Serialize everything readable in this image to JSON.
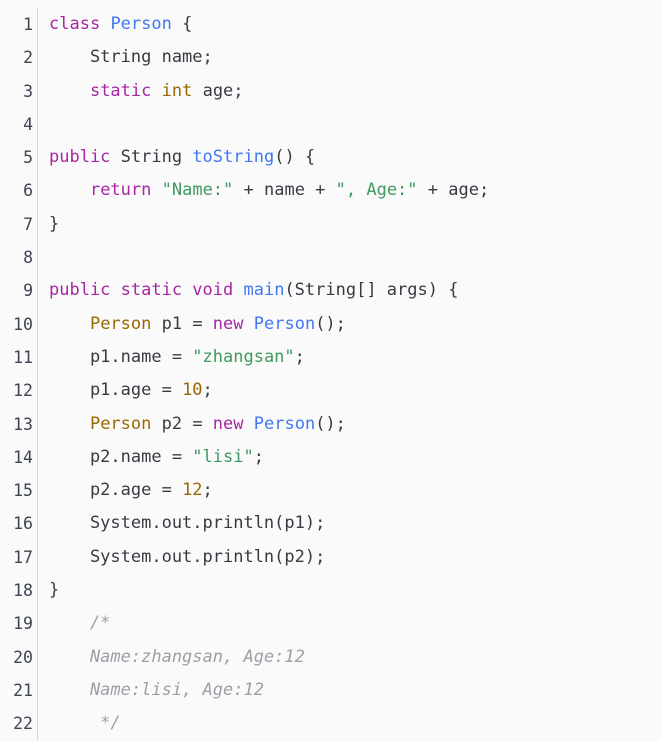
{
  "editor": {
    "language": "java",
    "background_color": "#fafafa",
    "gutter_separator_color": "#d7d7d7",
    "total_lines": 22,
    "palette": {
      "keyword": "#a626a4",
      "class_name": "#4078f2",
      "type": "#986801",
      "number": "#986801",
      "string": "#3f9960",
      "plain": "#383a42",
      "comment": "#9ca0a6",
      "line_number": "#3f4451"
    }
  },
  "lines": [
    {
      "n": "1",
      "tokens": [
        {
          "t": "class",
          "c": "kw"
        },
        {
          "t": " ",
          "c": "pln"
        },
        {
          "t": "Person",
          "c": "cls"
        },
        {
          "t": " {",
          "c": "pln"
        }
      ]
    },
    {
      "n": "2",
      "tokens": [
        {
          "t": "    String name;",
          "c": "pln"
        }
      ]
    },
    {
      "n": "3",
      "tokens": [
        {
          "t": "    ",
          "c": "pln"
        },
        {
          "t": "static",
          "c": "kw"
        },
        {
          "t": " ",
          "c": "pln"
        },
        {
          "t": "int",
          "c": "typ"
        },
        {
          "t": " age;",
          "c": "pln"
        }
      ]
    },
    {
      "n": "4",
      "tokens": [
        {
          "t": "",
          "c": "pln"
        }
      ]
    },
    {
      "n": "5",
      "tokens": [
        {
          "t": "public",
          "c": "kw"
        },
        {
          "t": " String ",
          "c": "pln"
        },
        {
          "t": "toString",
          "c": "cls"
        },
        {
          "t": "() {",
          "c": "pln"
        }
      ]
    },
    {
      "n": "6",
      "tokens": [
        {
          "t": "    ",
          "c": "pln"
        },
        {
          "t": "return",
          "c": "kw"
        },
        {
          "t": " ",
          "c": "pln"
        },
        {
          "t": "\"Name:\"",
          "c": "str"
        },
        {
          "t": " + name + ",
          "c": "pln"
        },
        {
          "t": "\", Age:\"",
          "c": "str"
        },
        {
          "t": " + age;",
          "c": "pln"
        }
      ]
    },
    {
      "n": "7",
      "tokens": [
        {
          "t": "}",
          "c": "pln"
        }
      ]
    },
    {
      "n": "8",
      "tokens": [
        {
          "t": "",
          "c": "pln"
        }
      ]
    },
    {
      "n": "9",
      "tokens": [
        {
          "t": "public static void",
          "c": "kw"
        },
        {
          "t": " ",
          "c": "pln"
        },
        {
          "t": "main",
          "c": "cls"
        },
        {
          "t": "(String[] args) {",
          "c": "pln"
        }
      ]
    },
    {
      "n": "10",
      "tokens": [
        {
          "t": "    ",
          "c": "pln"
        },
        {
          "t": "Person",
          "c": "typ"
        },
        {
          "t": " p1 = ",
          "c": "pln"
        },
        {
          "t": "new",
          "c": "kw"
        },
        {
          "t": " ",
          "c": "pln"
        },
        {
          "t": "Person",
          "c": "cls"
        },
        {
          "t": "();",
          "c": "pln"
        }
      ]
    },
    {
      "n": "11",
      "tokens": [
        {
          "t": "    p1.name = ",
          "c": "pln"
        },
        {
          "t": "\"zhangsan\"",
          "c": "str"
        },
        {
          "t": ";",
          "c": "pln"
        }
      ]
    },
    {
      "n": "12",
      "tokens": [
        {
          "t": "    p1.age = ",
          "c": "pln"
        },
        {
          "t": "10",
          "c": "num"
        },
        {
          "t": ";",
          "c": "pln"
        }
      ]
    },
    {
      "n": "13",
      "tokens": [
        {
          "t": "    ",
          "c": "pln"
        },
        {
          "t": "Person",
          "c": "typ"
        },
        {
          "t": " p2 = ",
          "c": "pln"
        },
        {
          "t": "new",
          "c": "kw"
        },
        {
          "t": " ",
          "c": "pln"
        },
        {
          "t": "Person",
          "c": "cls"
        },
        {
          "t": "();",
          "c": "pln"
        }
      ]
    },
    {
      "n": "14",
      "tokens": [
        {
          "t": "    p2.name = ",
          "c": "pln"
        },
        {
          "t": "\"lisi\"",
          "c": "str"
        },
        {
          "t": ";",
          "c": "pln"
        }
      ]
    },
    {
      "n": "15",
      "tokens": [
        {
          "t": "    p2.age = ",
          "c": "pln"
        },
        {
          "t": "12",
          "c": "num"
        },
        {
          "t": ";",
          "c": "pln"
        }
      ]
    },
    {
      "n": "16",
      "tokens": [
        {
          "t": "    System.out.println(p1);",
          "c": "pln"
        }
      ]
    },
    {
      "n": "17",
      "tokens": [
        {
          "t": "    System.out.println(p2);",
          "c": "pln"
        }
      ]
    },
    {
      "n": "18",
      "tokens": [
        {
          "t": "}",
          "c": "pln"
        }
      ]
    },
    {
      "n": "19",
      "tokens": [
        {
          "t": "    /*",
          "c": "cmt"
        }
      ]
    },
    {
      "n": "20",
      "tokens": [
        {
          "t": "    Name:zhangsan, Age:12",
          "c": "cmt"
        }
      ]
    },
    {
      "n": "21",
      "tokens": [
        {
          "t": "    Name:lisi, Age:12",
          "c": "cmt"
        }
      ]
    },
    {
      "n": "22",
      "tokens": [
        {
          "t": "     */",
          "c": "cmt"
        }
      ]
    }
  ]
}
